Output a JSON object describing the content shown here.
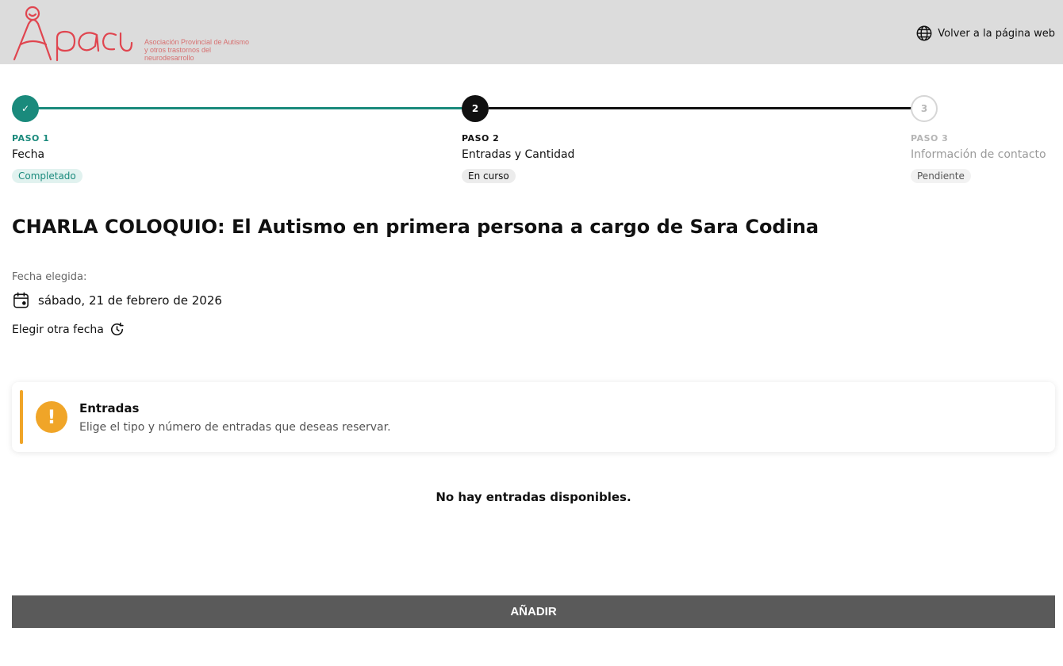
{
  "header": {
    "logo_text": "Apacu",
    "logo_subtitle_line1": "Asociación Provincial de Autismo",
    "logo_subtitle_line2": "y otros trastornos del neurodesarrollo",
    "back_link_label": "Volver a la página web",
    "back_link_icon": "globe-icon"
  },
  "stepper": {
    "steps": [
      {
        "number": "1",
        "check_icon": "✓",
        "label": "PASO 1",
        "title": "Fecha",
        "status": "Completado"
      },
      {
        "number": "2",
        "label": "PASO 2",
        "title": "Entradas y Cantidad",
        "status": "En curso"
      },
      {
        "number": "3",
        "label": "PASO 3",
        "title": "Información de contacto",
        "status": "Pendiente"
      }
    ],
    "colors": {
      "completed": "#1a8a7c",
      "current": "#111111",
      "pending": "#d6d6d6"
    }
  },
  "event": {
    "title": "CHARLA COLOQUIO: El Autismo en primera persona a cargo de Sara Codina",
    "date_label": "Fecha elegida:",
    "date_value": "sábado, 21 de febrero de 2026",
    "date_icon": "calendar-icon",
    "change_date_label": "Elegir otra fecha",
    "change_date_icon": "history-clock-icon"
  },
  "tickets_alert": {
    "icon": "!",
    "title": "Entradas",
    "text": "Elige el tipo y número de entradas que deseas reservar.",
    "accent_color": "#f0a528"
  },
  "empty_message": "No hay entradas disponibles.",
  "add_button_label": "AÑADIR"
}
